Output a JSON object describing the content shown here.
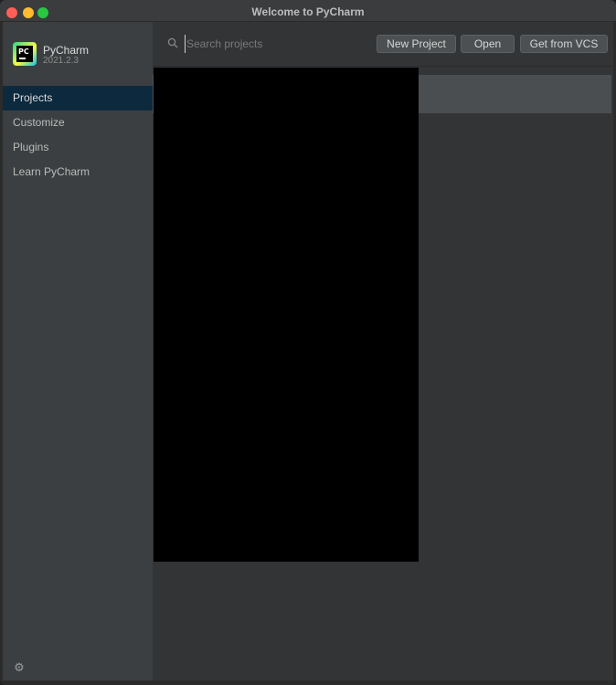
{
  "window": {
    "title": "Welcome to PyCharm"
  },
  "app": {
    "name": "PyCharm",
    "version": "2021.2.3"
  },
  "sidebar": {
    "items": [
      {
        "label": "Projects",
        "active": true
      },
      {
        "label": "Customize",
        "active": false
      },
      {
        "label": "Plugins",
        "active": false
      },
      {
        "label": "Learn PyCharm",
        "active": false
      }
    ],
    "settings_icon": "gear-icon"
  },
  "search": {
    "placeholder": "Search projects",
    "value": ""
  },
  "toolbar": {
    "new_project_label": "New Project",
    "open_label": "Open",
    "get_from_vcs_label": "Get from VCS"
  },
  "colors": {
    "active_nav": "#0d293e",
    "sidebar_bg": "#3c3f41",
    "main_bg": "#333436",
    "button_bg": "#4c5052"
  }
}
